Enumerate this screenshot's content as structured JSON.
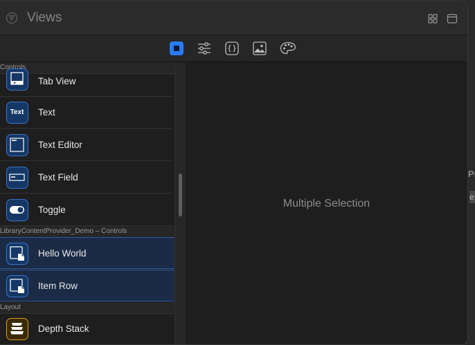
{
  "window": {
    "title": "Views",
    "title_icon": "filter-circle-icon",
    "toolbar_right": [
      "grid-view-icon",
      "panel-toggle-icon"
    ]
  },
  "library_tabs": [
    {
      "name": "views",
      "icon": "square-stop-icon",
      "active": true
    },
    {
      "name": "modifiers",
      "icon": "sliders-icon",
      "active": false
    },
    {
      "name": "snippets",
      "icon": "braces-icon",
      "active": false
    },
    {
      "name": "media",
      "icon": "photo-icon",
      "active": false
    },
    {
      "name": "colors",
      "icon": "palette-icon",
      "active": false
    }
  ],
  "sections": {
    "controls": "Controls",
    "custom": "LibraryContentProvider_Demo – Controls",
    "layout": "Layout"
  },
  "items": {
    "tab_view": "Tab View",
    "text": "Text",
    "text_icon_label": "Text",
    "text_editor": "Text Editor",
    "text_field": "Text Field",
    "toggle": "Toggle",
    "hello_world": "Hello World",
    "item_row": "Item Row",
    "depth_stack": "Depth Stack"
  },
  "selection": [
    "Hello World",
    "Item Row"
  ],
  "detail": {
    "placeholder": "Multiple Selection"
  },
  "colors": {
    "accent": "#2a7bf6",
    "selection_bg": "#1b2b45",
    "icon_blue": "#143765",
    "icon_orange": "#d9a020"
  }
}
